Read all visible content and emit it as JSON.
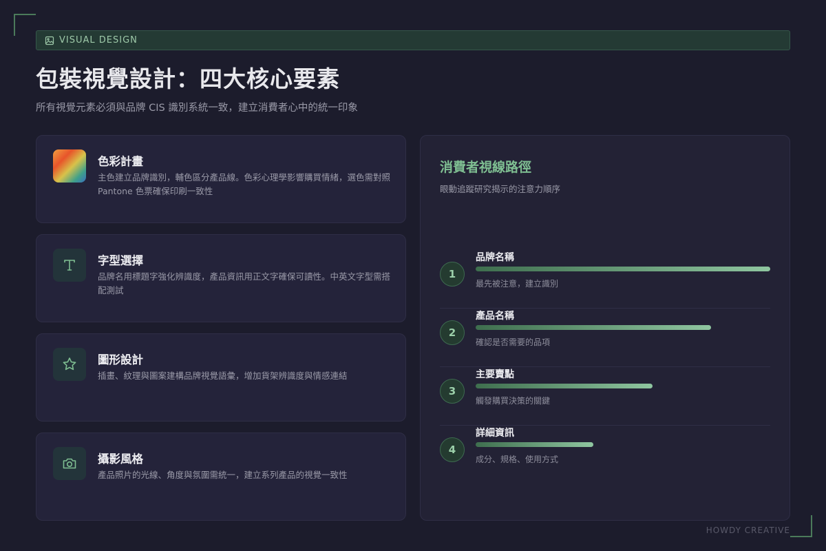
{
  "header": {
    "tag_label": "VISUAL DESIGN",
    "title": "包裝視覺設計：四大核心要素",
    "subtitle": "所有視覺元素必須與品牌 CIS 識別系統一致，建立消費者心中的統一印象"
  },
  "cards": [
    {
      "title": "色彩計畫",
      "desc": "主色建立品牌識別，輔色區分產品線。色彩心理學影響購買情緒，選色需對照 Pantone 色票確保印刷一致性",
      "icon": "color-palette-icon"
    },
    {
      "title": "字型選擇",
      "desc": "品牌名用標題字強化辨識度，產品資訊用正文字確保可讀性。中英文字型需搭配測試",
      "icon": "typography-icon"
    },
    {
      "title": "圖形設計",
      "desc": "插畫、紋理與圖案建構品牌視覺語彙，增加貨架辨識度與情感連結",
      "icon": "star-icon"
    },
    {
      "title": "攝影風格",
      "desc": "產品照片的光線、角度與氛圍需統一，建立系列產品的視覺一致性",
      "icon": "camera-icon"
    }
  ],
  "panel": {
    "title": "消費者視線路徑",
    "subtitle": "眼動追蹤研究揭示的注意力順序",
    "steps": [
      {
        "num": "1",
        "title": "品牌名稱",
        "desc": "最先被注意，建立識別",
        "level": 1.0
      },
      {
        "num": "2",
        "title": "產品名稱",
        "desc": "確認是否需要的品項",
        "level": 0.8
      },
      {
        "num": "3",
        "title": "主要賣點",
        "desc": "觸發購買決策的關鍵",
        "level": 0.6
      },
      {
        "num": "4",
        "title": "詳細資訊",
        "desc": "成分、規格、使用方式",
        "level": 0.4
      }
    ]
  },
  "footer": {
    "brand": "HOWDY CREATIVE"
  },
  "colors": {
    "accent": "#7fbf92",
    "background": "#1c1c2c",
    "card": "#24233a"
  }
}
